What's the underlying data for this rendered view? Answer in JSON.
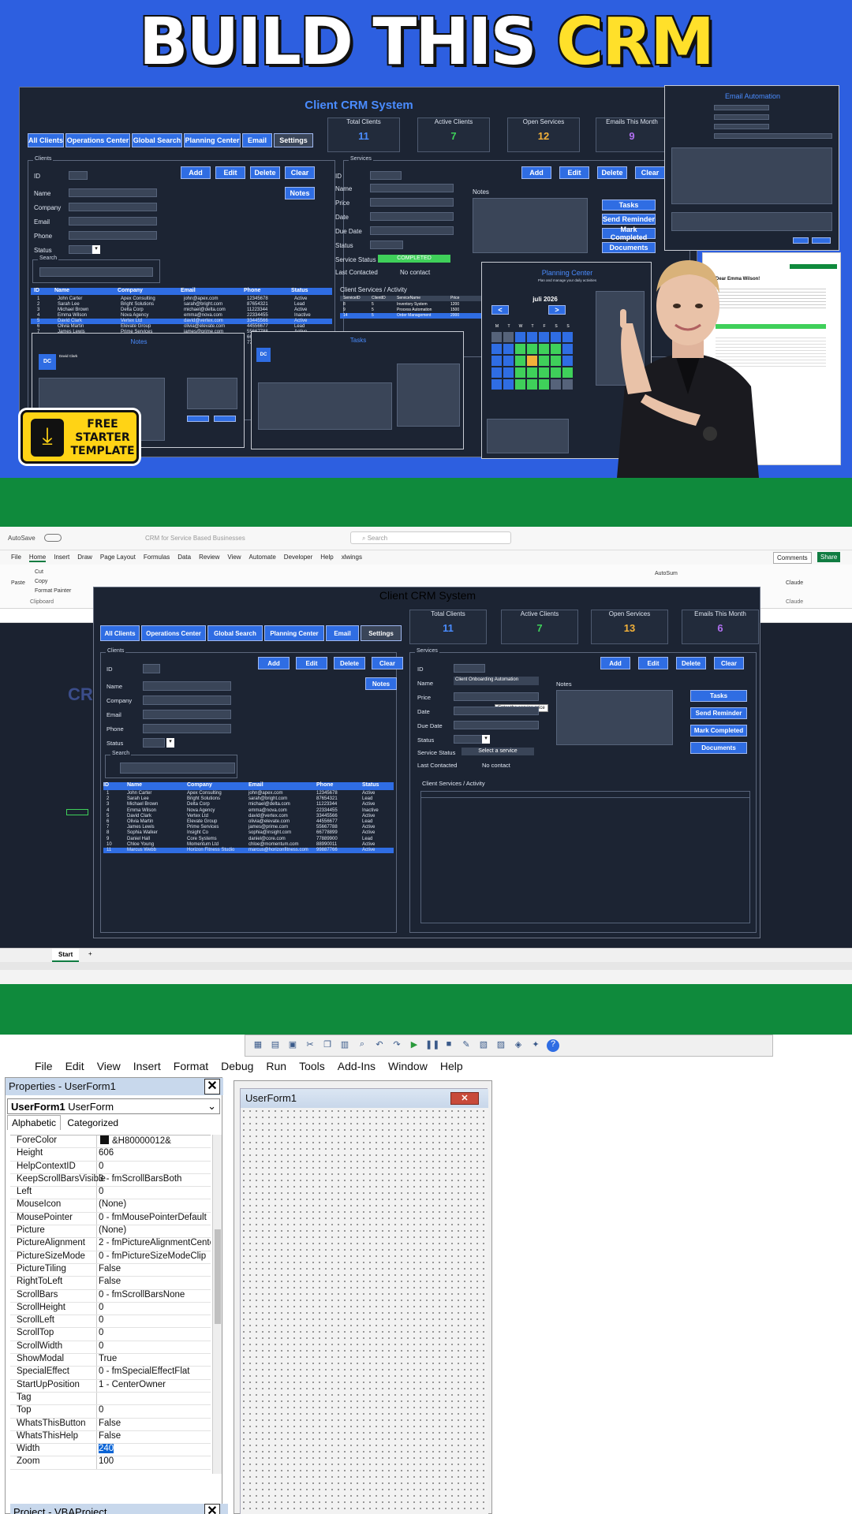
{
  "thumbnail": {
    "headline_part1": "BUILD THIS ",
    "headline_part2": "CRM",
    "badge_line1": "FREE",
    "badge_line2": "STARTER",
    "badge_line3": "TEMPLATE"
  },
  "crm": {
    "title": "Client CRM System",
    "tabs": [
      "All Clients",
      "Operations Center",
      "Global Search",
      "Planning Center",
      "Email",
      "Settings"
    ],
    "stats_thumb": [
      {
        "label": "Total Clients",
        "value": "11",
        "color": "#4a8cff"
      },
      {
        "label": "Active Clients",
        "value": "7",
        "color": "#3fd05a"
      },
      {
        "label": "Open Services",
        "value": "12",
        "color": "#f2b13a"
      },
      {
        "label": "Emails This Month",
        "value": "9",
        "color": "#b06ff0"
      }
    ],
    "stats_excel": [
      {
        "label": "Total Clients",
        "value": "11",
        "color": "#4a8cff"
      },
      {
        "label": "Active Clients",
        "value": "7",
        "color": "#3fd05a"
      },
      {
        "label": "Open Services",
        "value": "13",
        "color": "#f2b13a"
      },
      {
        "label": "Emails This Month",
        "value": "6",
        "color": "#b06ff0"
      }
    ],
    "clients_group": "Clients",
    "services_group": "Services",
    "search_group": "Search",
    "client_fields": [
      "ID",
      "Name",
      "Company",
      "Email",
      "Phone",
      "Status"
    ],
    "service_fields": [
      "ID",
      "Name",
      "Price",
      "Date",
      "Due Date",
      "Status"
    ],
    "buttons": {
      "add": "Add",
      "edit": "Edit",
      "delete": "Delete",
      "clear": "Clear",
      "notes": "Notes"
    },
    "service_buttons": [
      "Tasks",
      "Send Reminder",
      "Mark Completed",
      "Documents"
    ],
    "notes_label": "Notes",
    "service_status_label": "Service Status",
    "service_status_value_thumb": "COMPLETED",
    "service_status_value_excel": "Select a service",
    "last_contacted_label": "Last Contacted",
    "last_contacted_value": "No contact",
    "activity_label": "Client Services / Activity",
    "service_name_value": "Client Onboarding Automation",
    "price_tooltip": "Enter the service price",
    "table_headers": [
      "ID",
      "Name",
      "Company",
      "Email",
      "Phone",
      "Status"
    ],
    "clients": [
      [
        "1",
        "John Carter",
        "Apex Consulting",
        "john@apex.com",
        "12345678",
        "Active"
      ],
      [
        "2",
        "Sarah Lee",
        "Bright Solutions",
        "sarah@bright.com",
        "87654321",
        "Lead"
      ],
      [
        "3",
        "Michael Brown",
        "Delta Corp",
        "michael@delta.com",
        "11223344",
        "Active"
      ],
      [
        "4",
        "Emma Wilson",
        "Nova Agency",
        "emma@nova.com",
        "22334455",
        "Inactive"
      ],
      [
        "5",
        "David Clark",
        "Vertex Ltd",
        "david@vertex.com",
        "33445566",
        "Active"
      ],
      [
        "6",
        "Olivia Martin",
        "Elevate Group",
        "olivia@elevate.com",
        "44556677",
        "Lead"
      ],
      [
        "7",
        "James Lewis",
        "Prime Services",
        "james@prime.com",
        "55667788",
        "Active"
      ],
      [
        "8",
        "Sophia Walker",
        "Insight Co",
        "sophia@insight.com",
        "66778899",
        "Active"
      ],
      [
        "9",
        "Daniel Hall",
        "Core Systems",
        "daniel@core.com",
        "77889900",
        "Lead"
      ],
      [
        "10",
        "Chloe Young",
        "Momentum Ltd",
        "chloe@momentum.com",
        "88990011",
        "Active"
      ],
      [
        "11",
        "Marcus Webb",
        "Horizon Fitness Studio",
        "marcus@horizonfitness.com",
        "99887766",
        "Active"
      ]
    ],
    "services_headers": [
      "ServiceID",
      "ClientID",
      "ServiceName",
      "Price"
    ],
    "services_rows": [
      [
        "8",
        "5",
        "Inventory System",
        "1200"
      ],
      [
        "9",
        "5",
        "Process Automation",
        "1500"
      ],
      [
        "14",
        "5",
        "Order Management",
        "2000"
      ]
    ]
  },
  "overlays": {
    "email_title": "Email Automation",
    "email_greeting": "Dear Emma Wilson!",
    "planning_title": "Planning Center",
    "planning_subtitle": "Plan and manage your daily activities",
    "planning_month": "juli 2026",
    "notes_title": "Notes",
    "tasks_title": "Tasks",
    "notes_client_initials": "DC",
    "tasks_client_initials": "DC",
    "notes_client_name": "David Clark"
  },
  "excel": {
    "autosave": "AutoSave",
    "file_name": "CRM for Service Based Businesses",
    "search_placeholder": "Search",
    "menu": [
      "File",
      "Home",
      "Insert",
      "Draw",
      "Page Layout",
      "Formulas",
      "Data",
      "Review",
      "View",
      "Automate",
      "Developer",
      "Help",
      "xlwings"
    ],
    "comments": "Comments",
    "share": "Share",
    "clipboard": [
      "Cut",
      "Copy",
      "Format Painter"
    ],
    "paste": "Paste",
    "clipboard_group": "Clipboard",
    "autosum": "AutoSum",
    "ribbon_right": [
      "Claude",
      "Claude"
    ],
    "sheet_tab": "Start",
    "bg_title": "CR"
  },
  "vba": {
    "menu": [
      "File",
      "Edit",
      "View",
      "Insert",
      "Format",
      "Debug",
      "Run",
      "Tools",
      "Add-Ins",
      "Window",
      "Help"
    ],
    "properties_title": "Properties - UserForm1",
    "object_combo_bold": "UserForm1",
    "object_combo_rest": " UserForm",
    "tab_alphabetic": "Alphabetic",
    "tab_categorized": "Categorized",
    "properties": [
      [
        "ForeColor",
        "&H80000012&"
      ],
      [
        "Height",
        "606"
      ],
      [
        "HelpContextID",
        "0"
      ],
      [
        "KeepScrollBarsVisible",
        "3 - fmScrollBarsBoth"
      ],
      [
        "Left",
        "0"
      ],
      [
        "MouseIcon",
        "(None)"
      ],
      [
        "MousePointer",
        "0 - fmMousePointerDefault"
      ],
      [
        "Picture",
        "(None)"
      ],
      [
        "PictureAlignment",
        "2 - fmPictureAlignmentCente"
      ],
      [
        "PictureSizeMode",
        "0 - fmPictureSizeModeClip"
      ],
      [
        "PictureTiling",
        "False"
      ],
      [
        "RightToLeft",
        "False"
      ],
      [
        "ScrollBars",
        "0 - fmScrollBarsNone"
      ],
      [
        "ScrollHeight",
        "0"
      ],
      [
        "ScrollLeft",
        "0"
      ],
      [
        "ScrollTop",
        "0"
      ],
      [
        "ScrollWidth",
        "0"
      ],
      [
        "ShowModal",
        "True"
      ],
      [
        "SpecialEffect",
        "0 - fmSpecialEffectFlat"
      ],
      [
        "StartUpPosition",
        "1 - CenterOwner"
      ],
      [
        "Tag",
        ""
      ],
      [
        "Top",
        "0"
      ],
      [
        "WhatsThisButton",
        "False"
      ],
      [
        "WhatsThisHelp",
        "False"
      ],
      [
        "Width",
        "240"
      ],
      [
        "Zoom",
        "100"
      ]
    ],
    "project_title": "Project - VBAProject",
    "userform_title": "UserForm1"
  },
  "colors": {
    "accent_blue": "#2f6de3",
    "thumbnail_bg": "#2d5fe0",
    "headline_yellow": "#ffe02a",
    "separator_green": "#0f8a3c",
    "form_bg": "#1c2433"
  }
}
